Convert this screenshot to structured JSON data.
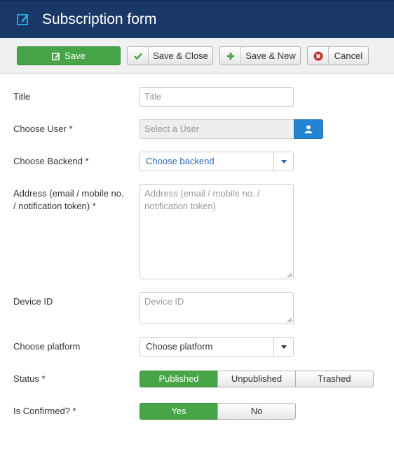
{
  "header": {
    "title": "Subscription form"
  },
  "toolbar": {
    "save_label": "Save",
    "save_close_label": "Save & Close",
    "save_new_label": "Save & New",
    "cancel_label": "Cancel"
  },
  "form": {
    "title": {
      "label": "Title",
      "placeholder": "Title"
    },
    "user": {
      "label": "Choose User *",
      "placeholder": "Select a User"
    },
    "backend": {
      "label": "Choose Backend *",
      "value": "Choose backend"
    },
    "address": {
      "label_line1": "Address (email / mobile no.",
      "label_line2": "/ notification token) *",
      "placeholder": "Address (email / mobile no. / notification token)"
    },
    "device": {
      "label": "Device ID",
      "placeholder": "Device ID"
    },
    "platform": {
      "label": "Choose platform",
      "value": "Choose platform"
    },
    "status": {
      "label": "Status *",
      "options": [
        "Published",
        "Unpublished",
        "Trashed"
      ],
      "selected": "Published"
    },
    "confirmed": {
      "label": "Is Confirmed? *",
      "options": [
        "Yes",
        "No"
      ],
      "selected": "Yes"
    }
  },
  "colors": {
    "header_bg": "#1a3867",
    "accent_green": "#46a546",
    "accent_blue": "#2384d3",
    "link_blue": "#2a69b8"
  }
}
